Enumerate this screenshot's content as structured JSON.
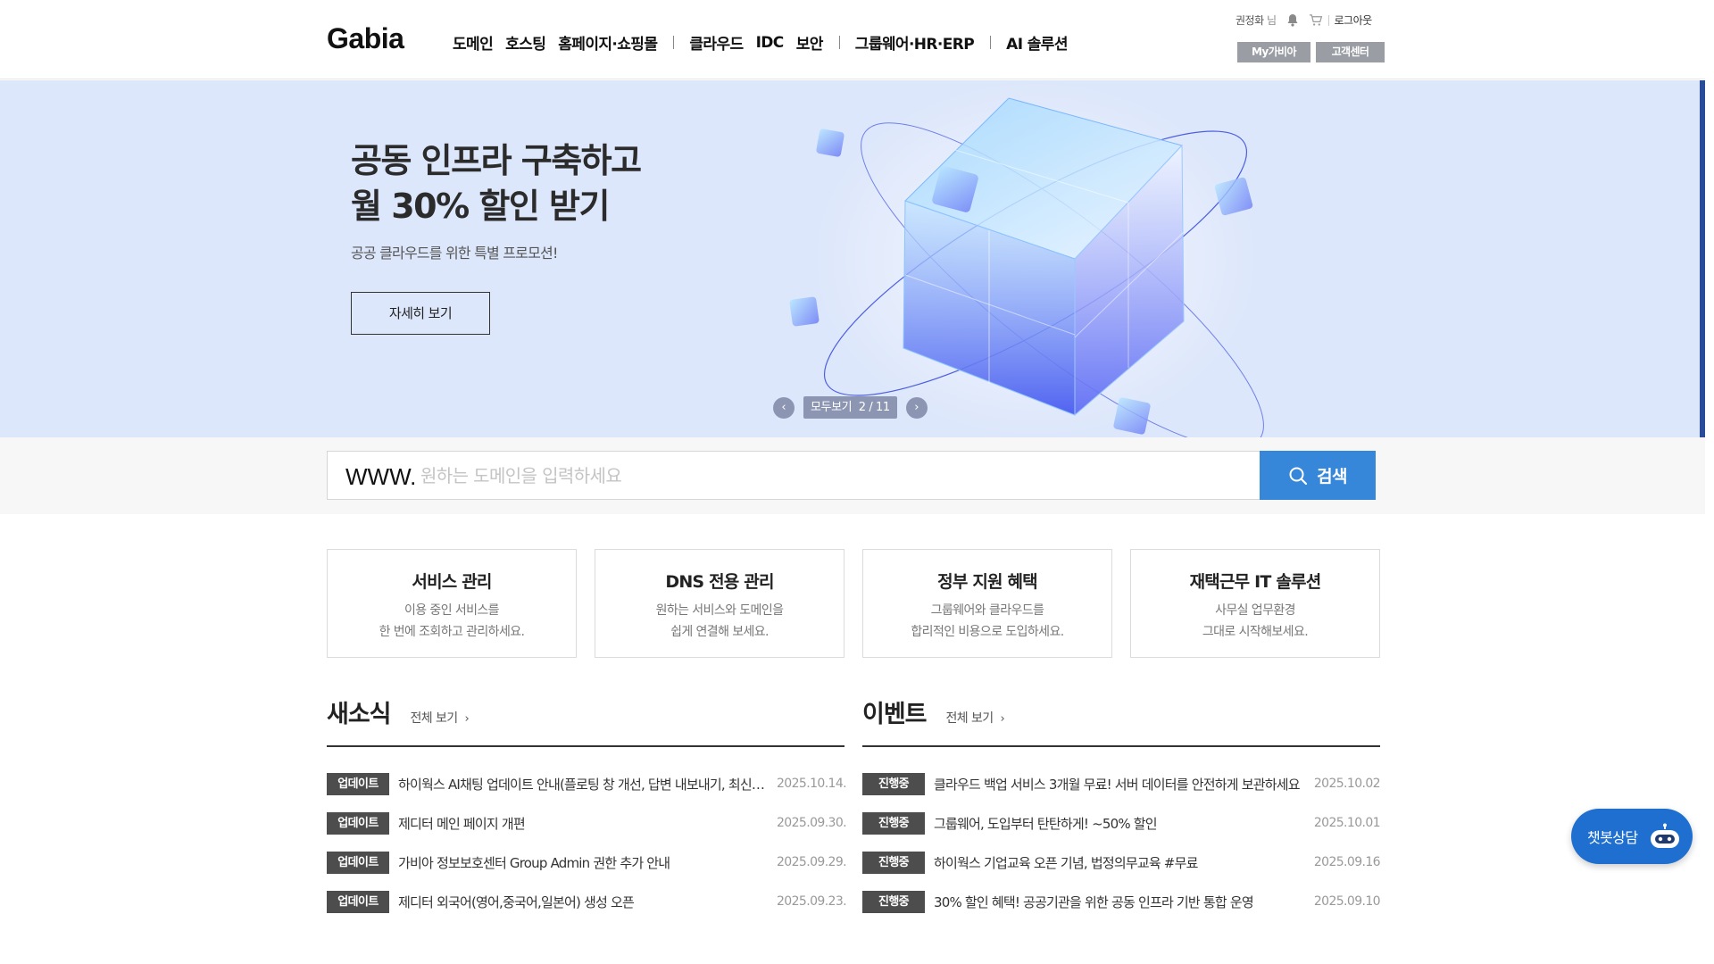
{
  "header": {
    "logo": "Gabia",
    "nav": [
      "도메인",
      "호스팅",
      "홈페이지·쇼핑몰",
      "클라우드",
      "IDC",
      "보안",
      "그룹웨어·HR·ERP",
      "AI 솔루션"
    ],
    "user_name": "권정화",
    "user_honorific": "님",
    "logout": "로그아웃",
    "my_gabia": "My가비아",
    "customer_center": "고객센터"
  },
  "hero": {
    "title_line1": "공동 인프라 구축하고",
    "title_line2": "월 30% 할인 받기",
    "subtitle": "공공 클라우드를 위한 특별 프로모션!",
    "cta": "자세히 보기",
    "view_all": "모두보기",
    "page_current": "2",
    "page_total": "11",
    "bg_color": "#dde7fb"
  },
  "search": {
    "prefix": "WWW.",
    "placeholder": "원하는 도메인을 입력하세요",
    "value": "",
    "button": "검색",
    "button_color": "#3687d9"
  },
  "cards": [
    {
      "title": "서비스 관리",
      "line1": "이용 중인 서비스를",
      "line2": "한 번에 조회하고 관리하세요."
    },
    {
      "title": "DNS 전용 관리",
      "line1": "원하는 서비스와 도메인을",
      "line2": "쉽게 연결해 보세요."
    },
    {
      "title": "정부 지원 혜택",
      "line1": "그룹웨어와 클라우드를",
      "line2": "합리적인 비용으로 도입하세요."
    },
    {
      "title": "재택근무 IT 솔루션",
      "line1": "사무실 업무환경",
      "line2": "그대로 시작해보세요."
    }
  ],
  "news": {
    "title": "새소식",
    "more": "전체 보기",
    "items": [
      {
        "badge": "업데이트",
        "title": "하이웍스 AI채팅 업데이트 안내(플로팅 창 개선, 답변 내보내기, 최신 모델 추가)",
        "date": "2025.10.14."
      },
      {
        "badge": "업데이트",
        "title": "제디터 메인 페이지 개편",
        "date": "2025.09.30."
      },
      {
        "badge": "업데이트",
        "title": "가비아 정보보호센터 Group Admin 권한 추가 안내",
        "date": "2025.09.29."
      },
      {
        "badge": "업데이트",
        "title": "제디터 외국어(영어,중국어,일본어) 생성 오픈",
        "date": "2025.09.23."
      }
    ]
  },
  "events": {
    "title": "이벤트",
    "more": "전체 보기",
    "items": [
      {
        "badge": "진행중",
        "title": "클라우드 백업 서비스 3개월 무료! 서버 데이터를 안전하게 보관하세요",
        "date": "2025.10.02"
      },
      {
        "badge": "진행중",
        "title": "그룹웨어, 도입부터 탄탄하게! ~50% 할인",
        "date": "2025.10.01"
      },
      {
        "badge": "진행중",
        "title": "하이웍스 기업교육 오픈 기념, 법정의무교육 #무료",
        "date": "2025.09.16"
      },
      {
        "badge": "진행중",
        "title": "30% 할인 혜택! 공공기관을 위한 공동 인프라 기반 통합 운영",
        "date": "2025.09.10"
      }
    ]
  },
  "chatbot": {
    "label": "챗봇상담"
  }
}
